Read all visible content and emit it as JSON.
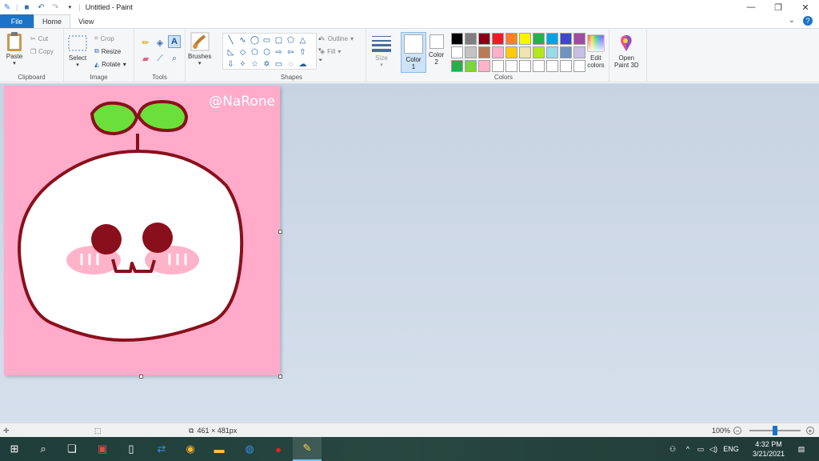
{
  "window": {
    "title": "Untitled - Paint",
    "controls": [
      "minimize-icon",
      "restore-icon",
      "close-icon"
    ]
  },
  "tabs": [
    {
      "label": "File"
    },
    {
      "label": "Home"
    },
    {
      "label": "View"
    }
  ],
  "ribbon": {
    "clipboard": {
      "label": "Clipboard",
      "paste": "Paste",
      "cut": "Cut",
      "copy": "Copy"
    },
    "image": {
      "label": "Image",
      "select": "Select",
      "crop": "Crop",
      "resize": "Resize",
      "rotate": "Rotate"
    },
    "tools": {
      "label": "Tools"
    },
    "brushes": {
      "label": "Brushes"
    },
    "shapes": {
      "label": "Shapes",
      "outline": "Outline",
      "fill": "Fill"
    },
    "size": {
      "label": "Size"
    },
    "color1": {
      "label": "Color",
      "num": "1"
    },
    "color2": {
      "label": "Color",
      "num": "2"
    },
    "colors": {
      "label": "Colors",
      "edit_label": "Edit",
      "edit_label2": "colors"
    },
    "paint3d": {
      "label": "Open",
      "label2": "Paint 3D"
    }
  },
  "palette": [
    "#000000",
    "#7f7f7f",
    "#880015",
    "#ed1c24",
    "#ff7f27",
    "#fff200",
    "#22b14c",
    "#00a2e8",
    "#3f48cc",
    "#a349a4",
    "#ffffff",
    "#c3c3c3",
    "#b97a57",
    "#ffaec9",
    "#ffc90e",
    "#efe4b0",
    "#b5e61d",
    "#99d9ea",
    "#7092be",
    "#c8bfe7",
    "#22b14c",
    "#7cd635",
    "#ffb3c9",
    "#ffffff",
    "#ffffff",
    "#ffffff",
    "#ffffff",
    "#ffffff",
    "#ffffff",
    "#ffffff"
  ],
  "canvas": {
    "background": "#ffabc9",
    "watermark": "@NaRone"
  },
  "statusbar": {
    "dimensions": "461 × 481px",
    "zoom": "100%"
  },
  "taskbar": {
    "time": "4:32 PM",
    "date": "3/21/2021",
    "language": "ENG"
  }
}
